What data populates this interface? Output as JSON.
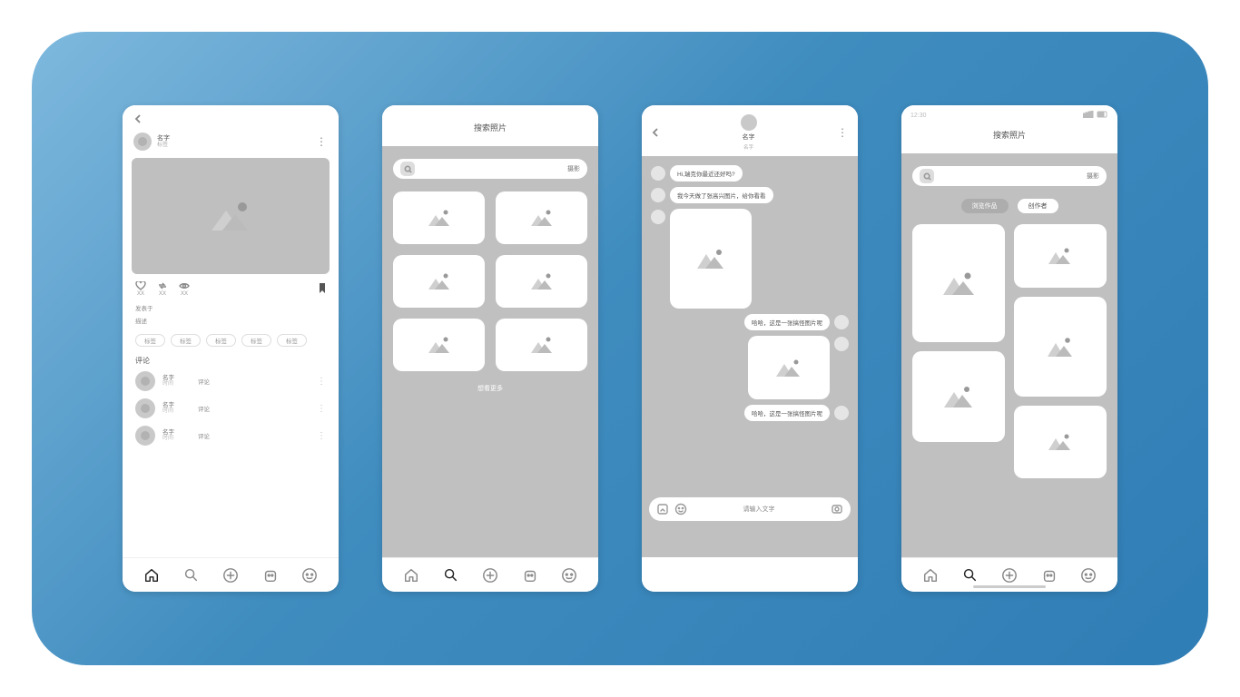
{
  "screen1": {
    "user": {
      "name": "名字",
      "sub": "标签"
    },
    "actions": {
      "like": "XX",
      "repost": "XX",
      "views": "XX"
    },
    "published_label": "发表于",
    "desc_label": "描述",
    "tags": [
      "标签",
      "标签",
      "标签",
      "标签",
      "标签"
    ],
    "comments_header": "评论",
    "comments": [
      {
        "name": "名字",
        "time": "时间",
        "text": "评论"
      },
      {
        "name": "名字",
        "time": "时间",
        "text": "评论"
      },
      {
        "name": "名字",
        "time": "时间",
        "text": "评论"
      }
    ]
  },
  "screen2": {
    "title": "搜索照片",
    "search_category": "摄影",
    "more": "想看更多"
  },
  "screen3": {
    "title": "名字",
    "subtitle": "名字",
    "msgs": {
      "m1": "Hi,瑞克你最近还好吗?",
      "m2": "我今天做了张高兴图片，给你看看",
      "m3": "哈哈，这是一张搞怪图片呢",
      "m4": "哈哈，这是一张搞怪图片呢"
    },
    "input_placeholder": "请输入文字"
  },
  "screen4": {
    "status_time": "12:30",
    "title": "搜索照片",
    "search_category": "摄影",
    "tabs": {
      "browse": "浏览作品",
      "creator": "创作者"
    }
  }
}
